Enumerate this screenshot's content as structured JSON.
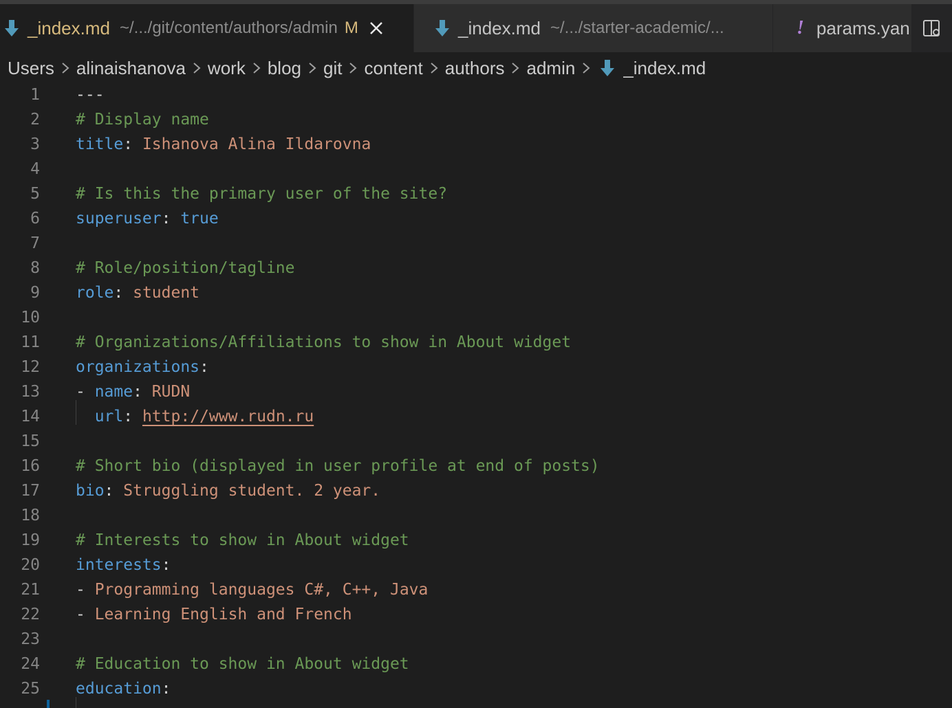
{
  "tabs": [
    {
      "name": "_index.md",
      "description": "~/.../git/content/authors/admin",
      "modified": "M",
      "icon": "markdown-arrow-icon",
      "active": true
    },
    {
      "name": "_index.md",
      "description": "~/.../starter-academic/...",
      "icon": "markdown-arrow-icon",
      "active": false
    },
    {
      "name": "params.yan",
      "icon": "yaml-exclamation-icon",
      "icon_glyph": "!",
      "active": false
    }
  ],
  "breadcrumb": [
    "Users",
    "alinaishanova",
    "work",
    "blog",
    "git",
    "content",
    "authors",
    "admin",
    "_index.md"
  ],
  "editor": {
    "lines": [
      {
        "n": "1",
        "parts": [
          {
            "t": "---",
            "c": "pun"
          }
        ]
      },
      {
        "n": "2",
        "parts": [
          {
            "t": "# Display name",
            "c": "cm"
          }
        ]
      },
      {
        "n": "3",
        "parts": [
          {
            "t": "title",
            "c": "key"
          },
          {
            "t": ": ",
            "c": "pun"
          },
          {
            "t": "Ishanova Alina Ildarovna",
            "c": "str"
          }
        ]
      },
      {
        "n": "4",
        "parts": []
      },
      {
        "n": "5",
        "parts": [
          {
            "t": "# Is this the primary user of the site?",
            "c": "cm"
          }
        ]
      },
      {
        "n": "6",
        "parts": [
          {
            "t": "superuser",
            "c": "key"
          },
          {
            "t": ": ",
            "c": "pun"
          },
          {
            "t": "true",
            "c": "bool"
          }
        ]
      },
      {
        "n": "7",
        "parts": []
      },
      {
        "n": "8",
        "parts": [
          {
            "t": "# Role/position/tagline",
            "c": "cm"
          }
        ]
      },
      {
        "n": "9",
        "parts": [
          {
            "t": "role",
            "c": "key"
          },
          {
            "t": ": ",
            "c": "pun"
          },
          {
            "t": "student",
            "c": "str"
          }
        ]
      },
      {
        "n": "10",
        "parts": []
      },
      {
        "n": "11",
        "parts": [
          {
            "t": "# Organizations/Affiliations to show in About widget",
            "c": "cm"
          }
        ]
      },
      {
        "n": "12",
        "parts": [
          {
            "t": "organizations",
            "c": "key"
          },
          {
            "t": ":",
            "c": "pun"
          }
        ]
      },
      {
        "n": "13",
        "parts": [
          {
            "t": "- ",
            "c": "pun"
          },
          {
            "t": "name",
            "c": "key"
          },
          {
            "t": ": ",
            "c": "pun"
          },
          {
            "t": "RUDN",
            "c": "str"
          }
        ]
      },
      {
        "n": "14",
        "parts": [
          {
            "t": "  ",
            "c": "pun"
          },
          {
            "t": "url",
            "c": "key"
          },
          {
            "t": ": ",
            "c": "pun"
          },
          {
            "t": "http://www.rudn.ru",
            "c": "link"
          }
        ]
      },
      {
        "n": "15",
        "parts": []
      },
      {
        "n": "16",
        "parts": [
          {
            "t": "# Short bio (displayed in user profile at end of posts)",
            "c": "cm"
          }
        ]
      },
      {
        "n": "17",
        "parts": [
          {
            "t": "bio",
            "c": "key"
          },
          {
            "t": ": ",
            "c": "pun"
          },
          {
            "t": "Struggling student. 2 year.",
            "c": "str"
          }
        ]
      },
      {
        "n": "18",
        "parts": []
      },
      {
        "n": "19",
        "parts": [
          {
            "t": "# Interests to show in About widget",
            "c": "cm"
          }
        ]
      },
      {
        "n": "20",
        "parts": [
          {
            "t": "interests",
            "c": "key"
          },
          {
            "t": ":",
            "c": "pun"
          }
        ]
      },
      {
        "n": "21",
        "parts": [
          {
            "t": "- ",
            "c": "pun"
          },
          {
            "t": "Programming languages C#, C++, Java",
            "c": "str"
          }
        ]
      },
      {
        "n": "22",
        "parts": [
          {
            "t": "- ",
            "c": "pun"
          },
          {
            "t": "Learning English and French",
            "c": "str"
          }
        ]
      },
      {
        "n": "23",
        "parts": []
      },
      {
        "n": "24",
        "parts": [
          {
            "t": "# Education to show in About widget",
            "c": "cm"
          }
        ]
      },
      {
        "n": "25",
        "parts": [
          {
            "t": "education",
            "c": "key"
          },
          {
            "t": ":",
            "c": "pun"
          }
        ]
      }
    ]
  },
  "colors": {
    "background": "#1e1e1e",
    "tab_modified": "#d7ba7d",
    "comment": "#6a9955",
    "key": "#569cd6",
    "string": "#ce9178",
    "markdown_icon": "#519aba",
    "yaml_icon": "#b180d7"
  }
}
